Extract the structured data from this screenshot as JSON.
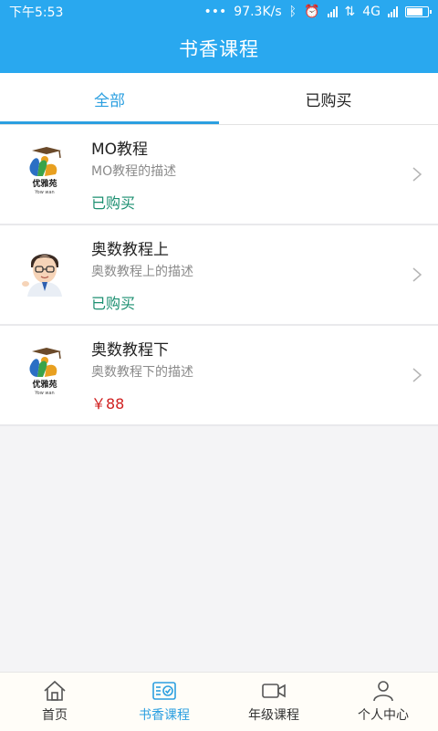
{
  "statusbar": {
    "time": "下午5:53",
    "speed": "97.3K/s",
    "network": "4G"
  },
  "header": {
    "title": "书香课程"
  },
  "tabs": [
    {
      "label": "全部",
      "active": true
    },
    {
      "label": "已购买",
      "active": false
    }
  ],
  "courses": [
    {
      "title": "MO教程",
      "desc": "MO教程的描述",
      "status": "已购买",
      "thumb": "youyanyuan-logo"
    },
    {
      "title": "奥数教程上",
      "desc": "奥数教程上的描述",
      "status": "已购买",
      "thumb": "cartoon-teacher-avatar"
    },
    {
      "title": "奥数教程下",
      "desc": "奥数教程下的描述",
      "status": "￥88",
      "thumb": "youyanyuan-logo"
    }
  ],
  "bottom_nav": [
    {
      "label": "首页",
      "icon": "home-icon",
      "active": false
    },
    {
      "label": "书香课程",
      "icon": "course-check-icon",
      "active": true
    },
    {
      "label": "年级课程",
      "icon": "video-camera-icon",
      "active": false
    },
    {
      "label": "个人中心",
      "icon": "person-icon",
      "active": false
    }
  ],
  "colors": {
    "primary": "#29a8ef",
    "accent": "#2b9fe0",
    "purchased": "#1b8f70",
    "price": "#d02020"
  }
}
